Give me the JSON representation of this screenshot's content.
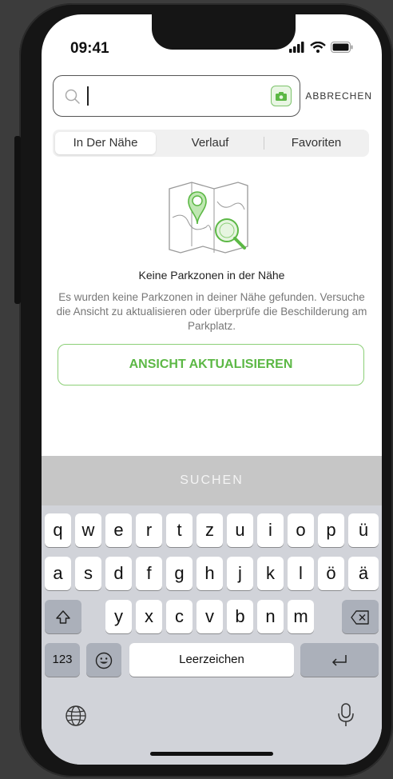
{
  "status": {
    "time": "09:41"
  },
  "search": {
    "placeholder": "",
    "value": "",
    "cancel_label": "ABBRECHEN"
  },
  "tabs": [
    {
      "label": "In Der Nähe",
      "active": true
    },
    {
      "label": "Verlauf",
      "active": false
    },
    {
      "label": "Favoriten",
      "active": false
    }
  ],
  "empty_state": {
    "title": "Keine Parkzonen in der Nähe",
    "message": "Es wurden keine Parkzonen in deiner Nähe gefunden. Versuche die Ansicht zu aktualisieren oder überprüfe die Beschilderung am Parkplatz.",
    "button_label": "ANSICHT AKTUALISIEREN"
  },
  "search_button_label": "SUCHEN",
  "keyboard": {
    "row1": [
      "q",
      "w",
      "e",
      "r",
      "t",
      "z",
      "u",
      "i",
      "o",
      "p",
      "ü"
    ],
    "row2": [
      "a",
      "s",
      "d",
      "f",
      "g",
      "h",
      "j",
      "k",
      "l",
      "ö",
      "ä"
    ],
    "row3": [
      "y",
      "x",
      "c",
      "v",
      "b",
      "n",
      "m"
    ],
    "numbers_label": "123",
    "space_label": "Leerzeichen"
  },
  "colors": {
    "accent": "#5cb845",
    "accent_light": "#8ccf77"
  }
}
